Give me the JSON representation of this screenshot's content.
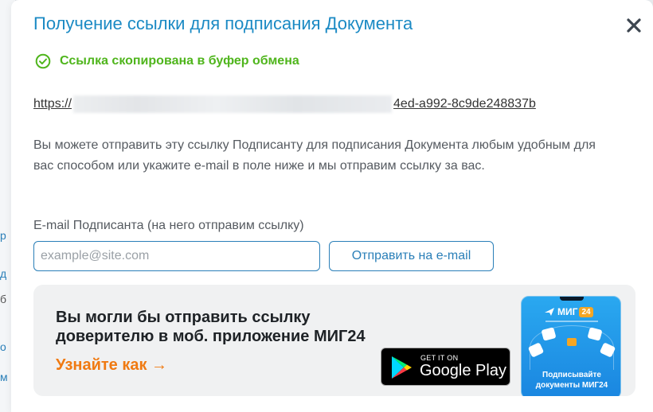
{
  "background": {
    "peek_chars": [
      "р",
      "д",
      "б",
      "о",
      "м"
    ]
  },
  "modal": {
    "title": "Получение ссылки для подписания Документа",
    "close_icon": "close-icon",
    "success_message": "Ссылка скопирована в буфер обмена",
    "link": {
      "prefix": "https://",
      "suffix": "4ed-a992-8c9de248837b"
    },
    "description": "Вы можете отправить эту ссылку Подписанту для подписания Документа любым удобным для вас способом или укажите e-mail в поле ниже и мы отправим ссылку за вас.",
    "email": {
      "label": "E-mail Подписанта (на него отправим ссылку)",
      "placeholder": "example@site.com",
      "value": ""
    },
    "send_button": "Отправить на e-mail",
    "promo": {
      "heading": "Вы могли бы отправить ссылку доверителю в моб. приложение МИГ24",
      "link_label": "Узнайте как →",
      "store_small": "GET IT ON",
      "store_big": "Google Play",
      "phone_brand": "МИГ",
      "phone_badge": "24",
      "phone_caption": "Подписывайте документы МИГ24"
    }
  },
  "colors": {
    "title": "#1b8ac4",
    "success": "#4fb51c",
    "accent": "#2a7fb8",
    "promo_link": "#f07a12"
  }
}
